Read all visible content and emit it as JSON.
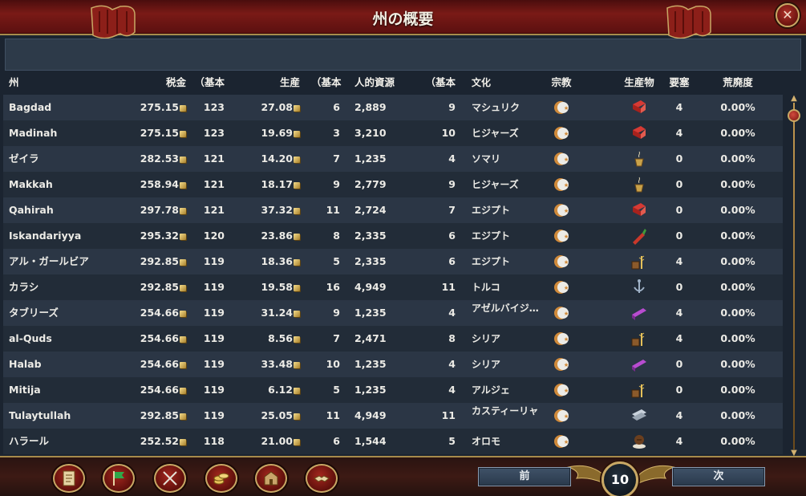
{
  "window": {
    "title": "州の概要",
    "close_icon": "close-icon"
  },
  "columns": {
    "name": "州",
    "tax": "税金",
    "tax_base": "（基本",
    "production": "生産",
    "prod_base": "（基本",
    "manpower": "人的資源",
    "mp_base": "（基本",
    "culture": "文化",
    "religion": "宗教",
    "goods": "生産物",
    "fort": "要塞",
    "devastation": "荒廃度"
  },
  "rows": [
    {
      "name": "Bagdad",
      "tax": "275.15",
      "tax_base": "123",
      "prod": "27.08",
      "prod_base": "6",
      "mp": "2,889",
      "mp_base": "9",
      "culture": "マシュリク",
      "goods": "cloth-icon",
      "fort": "4",
      "dev": "0.00%"
    },
    {
      "name": "Madinah",
      "tax": "275.15",
      "tax_base": "123",
      "prod": "19.69",
      "prod_base": "3",
      "mp": "3,210",
      "mp_base": "10",
      "culture": "ヒジャーズ",
      "goods": "cloth-icon",
      "fort": "4",
      "dev": "0.00%"
    },
    {
      "name": "ゼイラ",
      "tax": "282.53",
      "tax_base": "121",
      "prod": "14.20",
      "prod_base": "7",
      "mp": "1,235",
      "mp_base": "4",
      "culture": "ソマリ",
      "goods": "incense-icon",
      "fort": "0",
      "dev": "0.00%"
    },
    {
      "name": "Makkah",
      "tax": "258.94",
      "tax_base": "121",
      "prod": "18.17",
      "prod_base": "9",
      "mp": "2,779",
      "mp_base": "9",
      "culture": "ヒジャーズ",
      "goods": "incense-icon",
      "fort": "0",
      "dev": "0.00%"
    },
    {
      "name": "Qahirah",
      "tax": "297.78",
      "tax_base": "121",
      "prod": "37.32",
      "prod_base": "11",
      "mp": "2,724",
      "mp_base": "7",
      "culture": "エジプト",
      "goods": "cloth-icon",
      "fort": "0",
      "dev": "0.00%"
    },
    {
      "name": "Iskandariyya",
      "tax": "295.32",
      "tax_base": "120",
      "prod": "23.86",
      "prod_base": "8",
      "mp": "2,335",
      "mp_base": "6",
      "culture": "エジプト",
      "goods": "spices-icon",
      "fort": "0",
      "dev": "0.00%"
    },
    {
      "name": "アル・ガールビア",
      "tax": "292.85",
      "tax_base": "119",
      "prod": "18.36",
      "prod_base": "5",
      "mp": "2,335",
      "mp_base": "6",
      "culture": "エジプト",
      "goods": "grain-icon",
      "fort": "4",
      "dev": "0.00%"
    },
    {
      "name": "カラシ",
      "tax": "292.85",
      "tax_base": "119",
      "prod": "19.58",
      "prod_base": "16",
      "mp": "4,949",
      "mp_base": "11",
      "culture": "トルコ",
      "goods": "naval-supplies-icon",
      "fort": "0",
      "dev": "0.00%"
    },
    {
      "name": "タブリーズ",
      "tax": "254.66",
      "tax_base": "119",
      "prod": "31.24",
      "prod_base": "9",
      "mp": "1,235",
      "mp_base": "4",
      "culture": "アゼルバイジ…",
      "goods": "silk-icon",
      "fort": "4",
      "dev": "0.00%"
    },
    {
      "name": "al-Quds",
      "tax": "254.66",
      "tax_base": "119",
      "prod": "8.56",
      "prod_base": "7",
      "mp": "2,471",
      "mp_base": "8",
      "culture": "シリア",
      "goods": "grain-icon",
      "fort": "4",
      "dev": "0.00%"
    },
    {
      "name": "Halab",
      "tax": "254.66",
      "tax_base": "119",
      "prod": "33.48",
      "prod_base": "10",
      "mp": "1,235",
      "mp_base": "4",
      "culture": "シリア",
      "goods": "silk-icon",
      "fort": "0",
      "dev": "0.00%"
    },
    {
      "name": "Mitija",
      "tax": "254.66",
      "tax_base": "119",
      "prod": "6.12",
      "prod_base": "5",
      "mp": "1,235",
      "mp_base": "4",
      "culture": "アルジェ",
      "goods": "grain-icon",
      "fort": "0",
      "dev": "0.00%"
    },
    {
      "name": "Tulaytullah",
      "tax": "292.85",
      "tax_base": "119",
      "prod": "25.05",
      "prod_base": "11",
      "mp": "4,949",
      "mp_base": "11",
      "culture": "カスティーリャ",
      "goods": "wool-icon",
      "fort": "4",
      "dev": "0.00%"
    },
    {
      "name": "ハラール",
      "tax": "252.52",
      "tax_base": "118",
      "prod": "21.00",
      "prod_base": "6",
      "mp": "1,544",
      "mp_base": "5",
      "culture": "オロモ",
      "goods": "coffee-icon",
      "fort": "4",
      "dev": "0.00%"
    }
  ],
  "religion_icon": "sunni-crescent-icon",
  "footer": {
    "prev_label": "前",
    "next_label": "次",
    "page": "10",
    "tools": [
      "ledger-icon",
      "flag-icon",
      "crossed-swords-icon",
      "coins-icon",
      "building-icon",
      "handshake-icon"
    ]
  },
  "colors": {
    "title_red": "#7a1a16",
    "gold_trim": "#c8a865",
    "row_light": "#2b3645",
    "row_dark": "#222c38"
  }
}
